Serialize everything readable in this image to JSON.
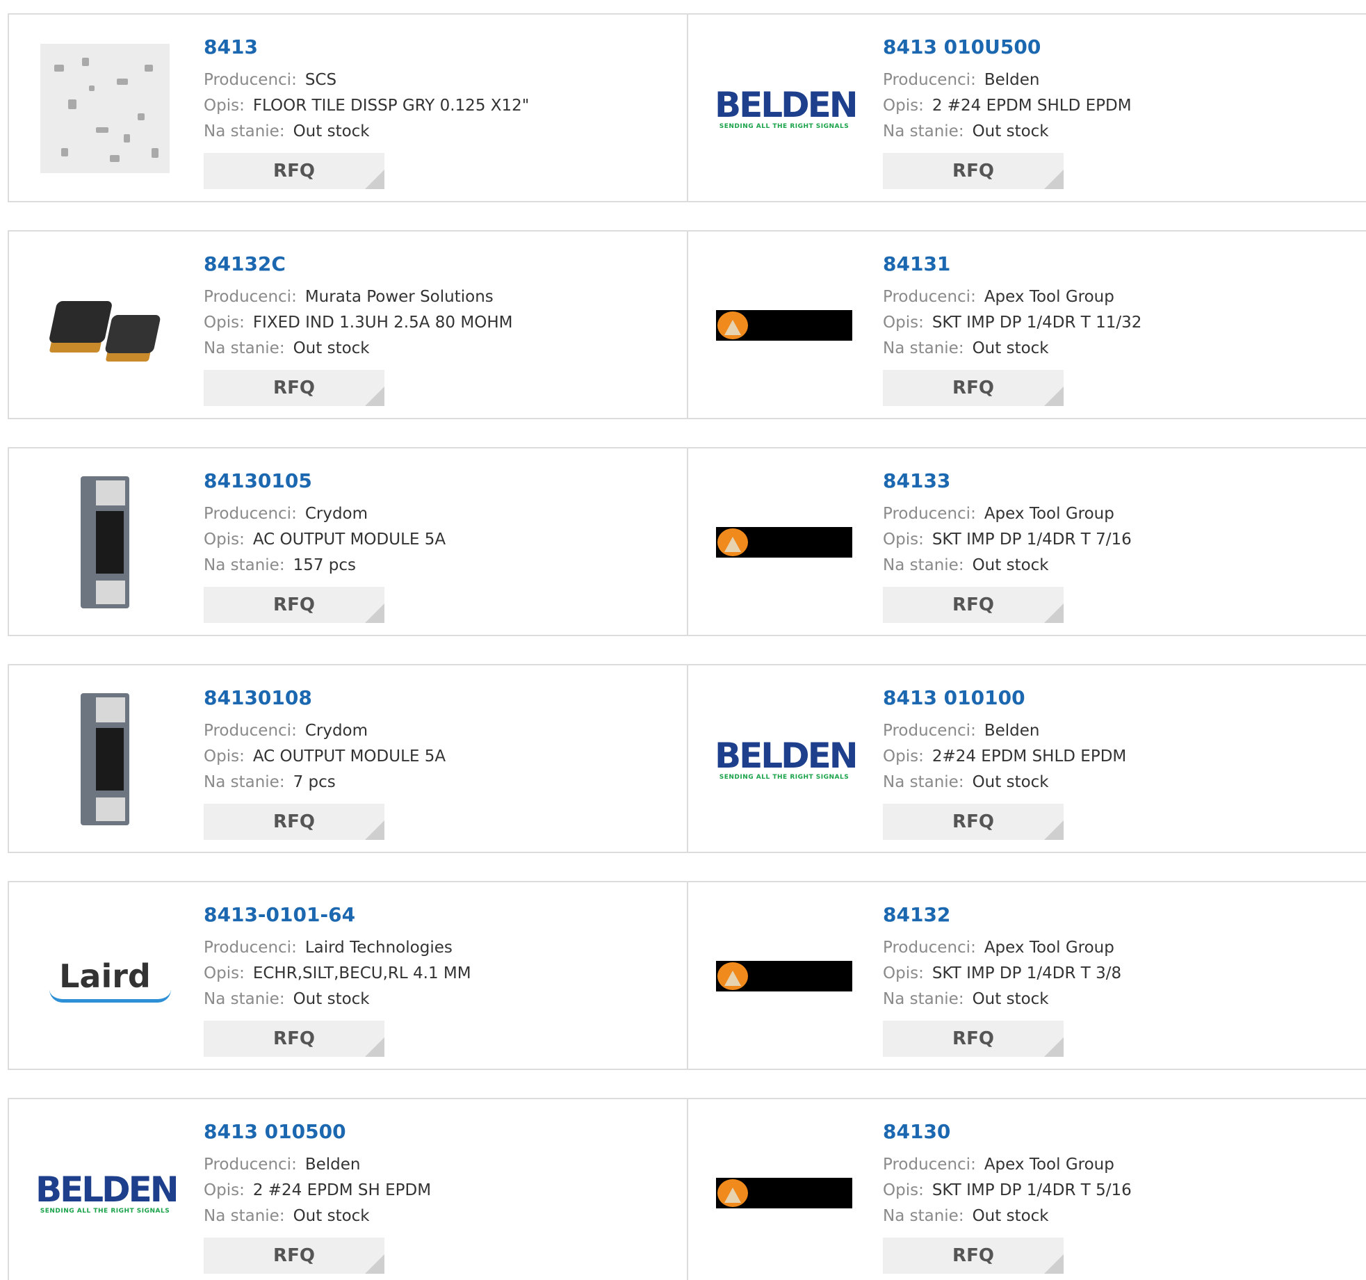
{
  "labels": {
    "manufacturer": "Producenci:",
    "description": "Opis:",
    "stock": "Na stanie:",
    "rfq": "RFQ"
  },
  "products": [
    {
      "pn": "8413",
      "manufacturer": "SCS",
      "description": "FLOOR TILE DISSP GRY 0.125 X12\"",
      "stock": "Out stock",
      "image": "floor-tile-image"
    },
    {
      "pn": "8413 010U500",
      "manufacturer": "Belden",
      "description": "2 #24 EPDM SHLD EPDM",
      "stock": "Out stock",
      "image": "belden-logo",
      "logo_tagline": "SENDING ALL THE RIGHT SIGNALS"
    },
    {
      "pn": "84132C",
      "manufacturer": "Murata Power Solutions",
      "description": "FIXED IND 1.3UH 2.5A 80 MOHM",
      "stock": "Out stock",
      "image": "inductor-image"
    },
    {
      "pn": "84131",
      "manufacturer": "Apex Tool Group",
      "description": "SKT IMP DP 1/4DR T 11/32",
      "stock": "Out stock",
      "image": "apex-logo"
    },
    {
      "pn": "84130105",
      "manufacturer": "Crydom",
      "description": "AC OUTPUT MODULE 5A",
      "stock": "157 pcs",
      "image": "relay-module-image"
    },
    {
      "pn": "84133",
      "manufacturer": "Apex Tool Group",
      "description": "SKT IMP DP 1/4DR T 7/16",
      "stock": "Out stock",
      "image": "apex-logo"
    },
    {
      "pn": "84130108",
      "manufacturer": "Crydom",
      "description": "AC OUTPUT MODULE 5A",
      "stock": "7 pcs",
      "image": "relay-module-image"
    },
    {
      "pn": "8413 010100",
      "manufacturer": "Belden",
      "description": "2#24 EPDM SHLD EPDM",
      "stock": "Out stock",
      "image": "belden-logo",
      "logo_tagline": "SENDING ALL THE RIGHT SIGNALS"
    },
    {
      "pn": "8413-0101-64",
      "manufacturer": "Laird Technologies",
      "description": "ECHR,SILT,BECU,RL 4.1 MM",
      "stock": "Out stock",
      "image": "laird-logo"
    },
    {
      "pn": "84132",
      "manufacturer": "Apex Tool Group",
      "description": "SKT IMP DP 1/4DR T 3/8",
      "stock": "Out stock",
      "image": "apex-logo"
    },
    {
      "pn": "8413 010500",
      "manufacturer": "Belden",
      "description": "2 #24 EPDM SH EPDM",
      "stock": "Out stock",
      "image": "belden-logo",
      "logo_tagline": "SENDING ALL THE RIGHT SIGNALS"
    },
    {
      "pn": "84130",
      "manufacturer": "Apex Tool Group",
      "description": "SKT IMP DP 1/4DR T 5/16",
      "stock": "Out stock",
      "image": "apex-logo"
    }
  ],
  "colors": {
    "link": "#1b67b0",
    "label": "#8a8a8a",
    "rfq_bg": "#efefef",
    "border": "#dcdcdc"
  }
}
